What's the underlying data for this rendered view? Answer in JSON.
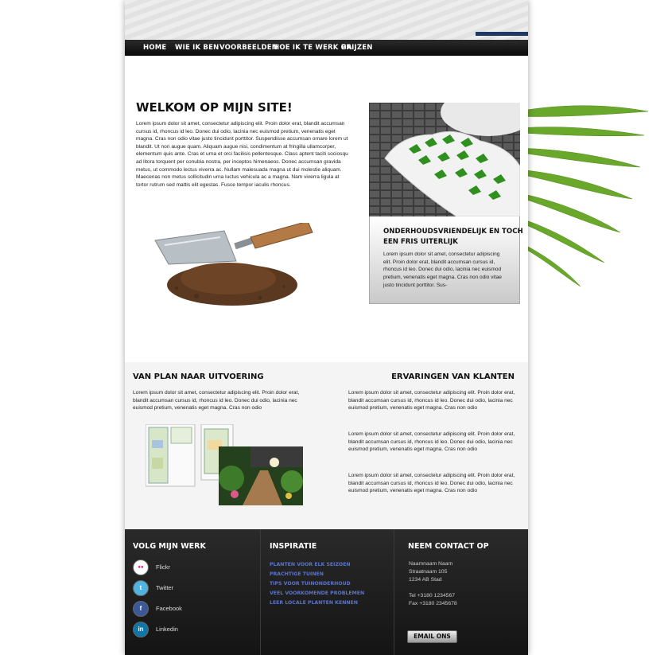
{
  "nav": {
    "items": [
      {
        "label": "HOME"
      },
      {
        "label": "WIE IK BEN"
      },
      {
        "label": "VOORBEELDEN"
      },
      {
        "label": "HOE IK TE WERK GA"
      },
      {
        "label": "PRIJZEN"
      }
    ]
  },
  "welcome": {
    "title": "WELKOM OP MIJN SITE!",
    "body": "Lorem ipsum dolor sit amet, consectetur adipiscing elit. Proin dolor erat, blandit accumsan cursus id, rhoncus id leo. Donec dui odio, lacinia nec euismod pretium, venenatis eget magna. Cras non odio vitae justo tincidunt porttitor. Suspendisse accumsan ornare lorem ut blandit. Ut non augue quam. Aliquam augue nisi, condimentum at fringilla ullamcorper, elementum quis ante. Cras et urna et orci facilisis pellentesque. Class aptent taciti sociosqu ad litora torquent per conubia nostra, per inceptos himenaeos. Donec accumsan gravida metus, ut commodo lectus viverra ac. Nullam malesuada magna ut dui molestie aliquam. Maecenas non metus sollicitudin urna luctus vehicula ac a magna. Nam viverra ligula at tortor rutrum sed mattis elit egestas. Fusce tempor iaculis rhoncus."
  },
  "feature": {
    "title_line1": "ONDERHOUDSVRIENDELIJK EN TOCH",
    "title_line2": "EEN FRIS UITERLIJK",
    "body": "Lorem ipsum dolor sit amet, consectetur adipiscing elit. Proin dolor erat, blandit accumsan cursus id, rhoncus id leo. Donec dui odio, lacinia nec euismod pretium, venenatis eget magna. Cras non odio vitae justo tincidunt porttitor. Sus-"
  },
  "plan": {
    "title": "VAN PLAN NAAR UITVOERING",
    "body": "Lorem ipsum dolor sit amet, consectetur adipiscing elit. Proin dolor erat, blandit accumsan cursus id, rhoncus id leo. Donec dui odio, lacinia nec euismod pretium, venenatis eget magna. Cras non odio"
  },
  "reviews": {
    "title": "ERVARINGEN VAN KLANTEN",
    "items": [
      {
        "text": "Lorem ipsum dolor sit amet, consectetur adipiscing elit. Proin dolor erat, blandit accumsan cursus id, rhoncus id leo. Donec dui odio, lacinia nec euismod pretium, venenatis eget magna. Cras non odio"
      },
      {
        "text": "Lorem ipsum dolor sit amet, consectetur adipiscing elit. Proin dolor erat, blandit accumsan cursus id, rhoncus id leo. Donec dui odio, lacinia nec euismod pretium, venenatis eget magna. Cras non odio"
      },
      {
        "text": "Lorem ipsum dolor sit amet, consectetur adipiscing elit. Proin dolor erat, blandit accumsan cursus id, rhoncus id leo. Donec dui odio, lacinia nec euismod pretium, venenatis eget magna. Cras non odio"
      }
    ]
  },
  "footer": {
    "follow": {
      "title": "VOLG MIJN WERK",
      "items": [
        {
          "label": "Flickr",
          "icon": "flickr-icon",
          "glyph": "●●"
        },
        {
          "label": "Twitter",
          "icon": "twitter-icon",
          "glyph": "t"
        },
        {
          "label": "Facebook",
          "icon": "facebook-icon",
          "glyph": "f"
        },
        {
          "label": "Linkedin",
          "icon": "linkedin-icon",
          "glyph": "in"
        }
      ]
    },
    "inspiration": {
      "title": "INSPIRATIE",
      "links": [
        {
          "label": "PLANTEN VOOR ELK SEIZOEN"
        },
        {
          "label": "PRACHTIGE TUINEN"
        },
        {
          "label": "TIPS VOOR TUINONDERHOUD"
        },
        {
          "label": "VEEL VOORKOMENDE PROBLEMEN"
        },
        {
          "label": "LEER LOCALE PLANTEN KENNEN"
        }
      ]
    },
    "contact": {
      "title": "NEEM CONTACT OP",
      "name": "Naamnaam Naam",
      "street": "Straatnaam 105",
      "city": "1234 AB Stad",
      "tel": "Tel  +3180 1234567",
      "fax": "Fax +3180 2345678",
      "email_label": "EMAIL ONS"
    }
  },
  "colors": {
    "nav_bg": "#111111",
    "header_accent": "#1e3a64",
    "link_blue": "#5a73c8",
    "footer_bg": "#1d1d1d",
    "flickr_pink": "#ff0084",
    "twitter_blue": "#4fb4e0",
    "facebook_blue": "#3b5998",
    "linkedin_blue": "#0e76a8"
  }
}
